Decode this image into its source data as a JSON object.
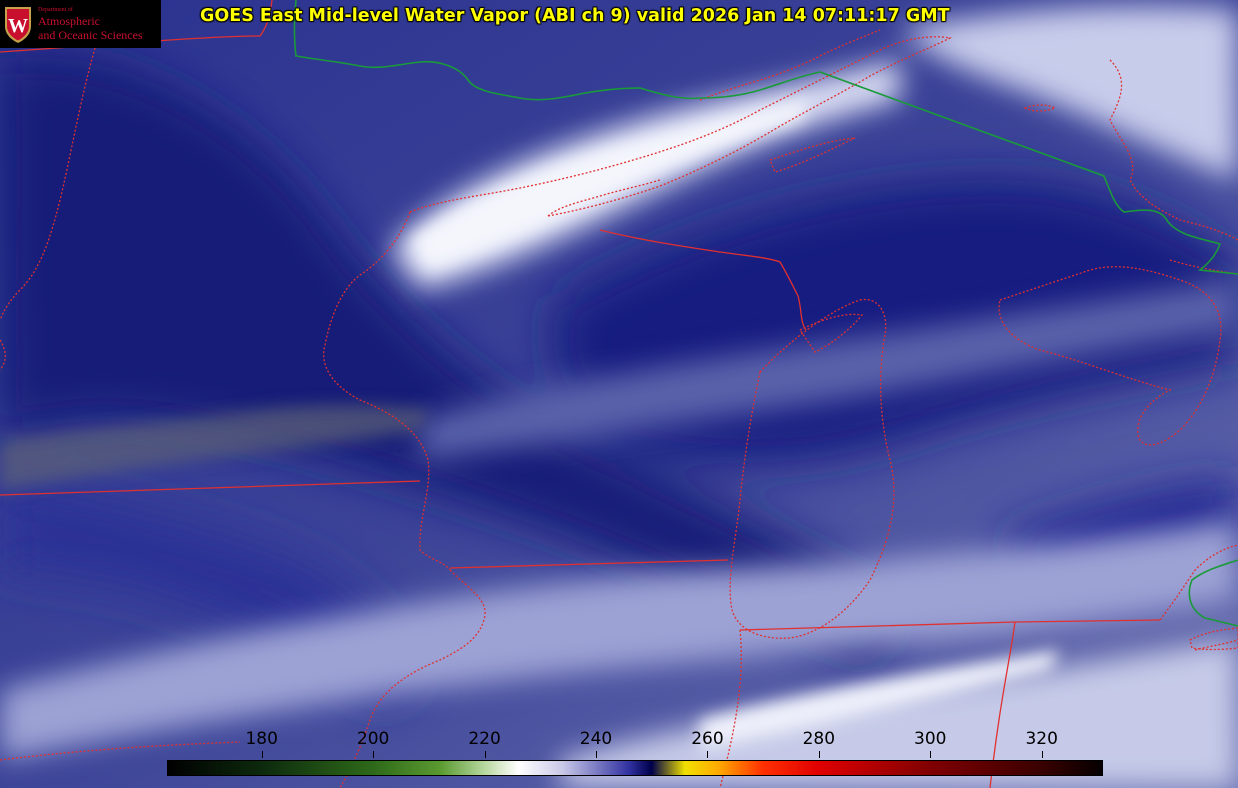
{
  "title": "GOES East Mid-level Water Vapor (ABI ch 9)  valid 2026 Jan 14 07:11:17 GMT",
  "logo": {
    "department_line": "Department of",
    "line1": "Atmospheric",
    "line2": "and Oceanic Sciences",
    "crest_letter": "W"
  },
  "colorbar": {
    "ticks": [
      "180",
      "200",
      "220",
      "240",
      "260",
      "280",
      "300",
      "320"
    ],
    "tick_values": [
      180,
      200,
      220,
      240,
      260,
      280,
      300,
      320
    ],
    "value_range": [
      163,
      331
    ],
    "stops": [
      {
        "value": 163,
        "color": "#000000"
      },
      {
        "value": 180,
        "color": "#0d2a0d"
      },
      {
        "value": 200,
        "color": "#2e6a1a"
      },
      {
        "value": 212,
        "color": "#5a9a30"
      },
      {
        "value": 220,
        "color": "#b8d8a0"
      },
      {
        "value": 226,
        "color": "#ffffff"
      },
      {
        "value": 234,
        "color": "#c8c8e8"
      },
      {
        "value": 246,
        "color": "#3030a0"
      },
      {
        "value": 250,
        "color": "#00004a"
      },
      {
        "value": 256,
        "color": "#f0e000"
      },
      {
        "value": 262,
        "color": "#ffaa00"
      },
      {
        "value": 270,
        "color": "#ff3000"
      },
      {
        "value": 280,
        "color": "#e00000"
      },
      {
        "value": 300,
        "color": "#800000"
      },
      {
        "value": 320,
        "color": "#3a0000"
      },
      {
        "value": 331,
        "color": "#050000"
      }
    ]
  },
  "colors": {
    "state_border": "#e03030",
    "international_border": "#1a9a3a",
    "imagery_dark": "#121a70",
    "imagery_light": "#e8ecf8",
    "title_text": "#ffff00"
  }
}
